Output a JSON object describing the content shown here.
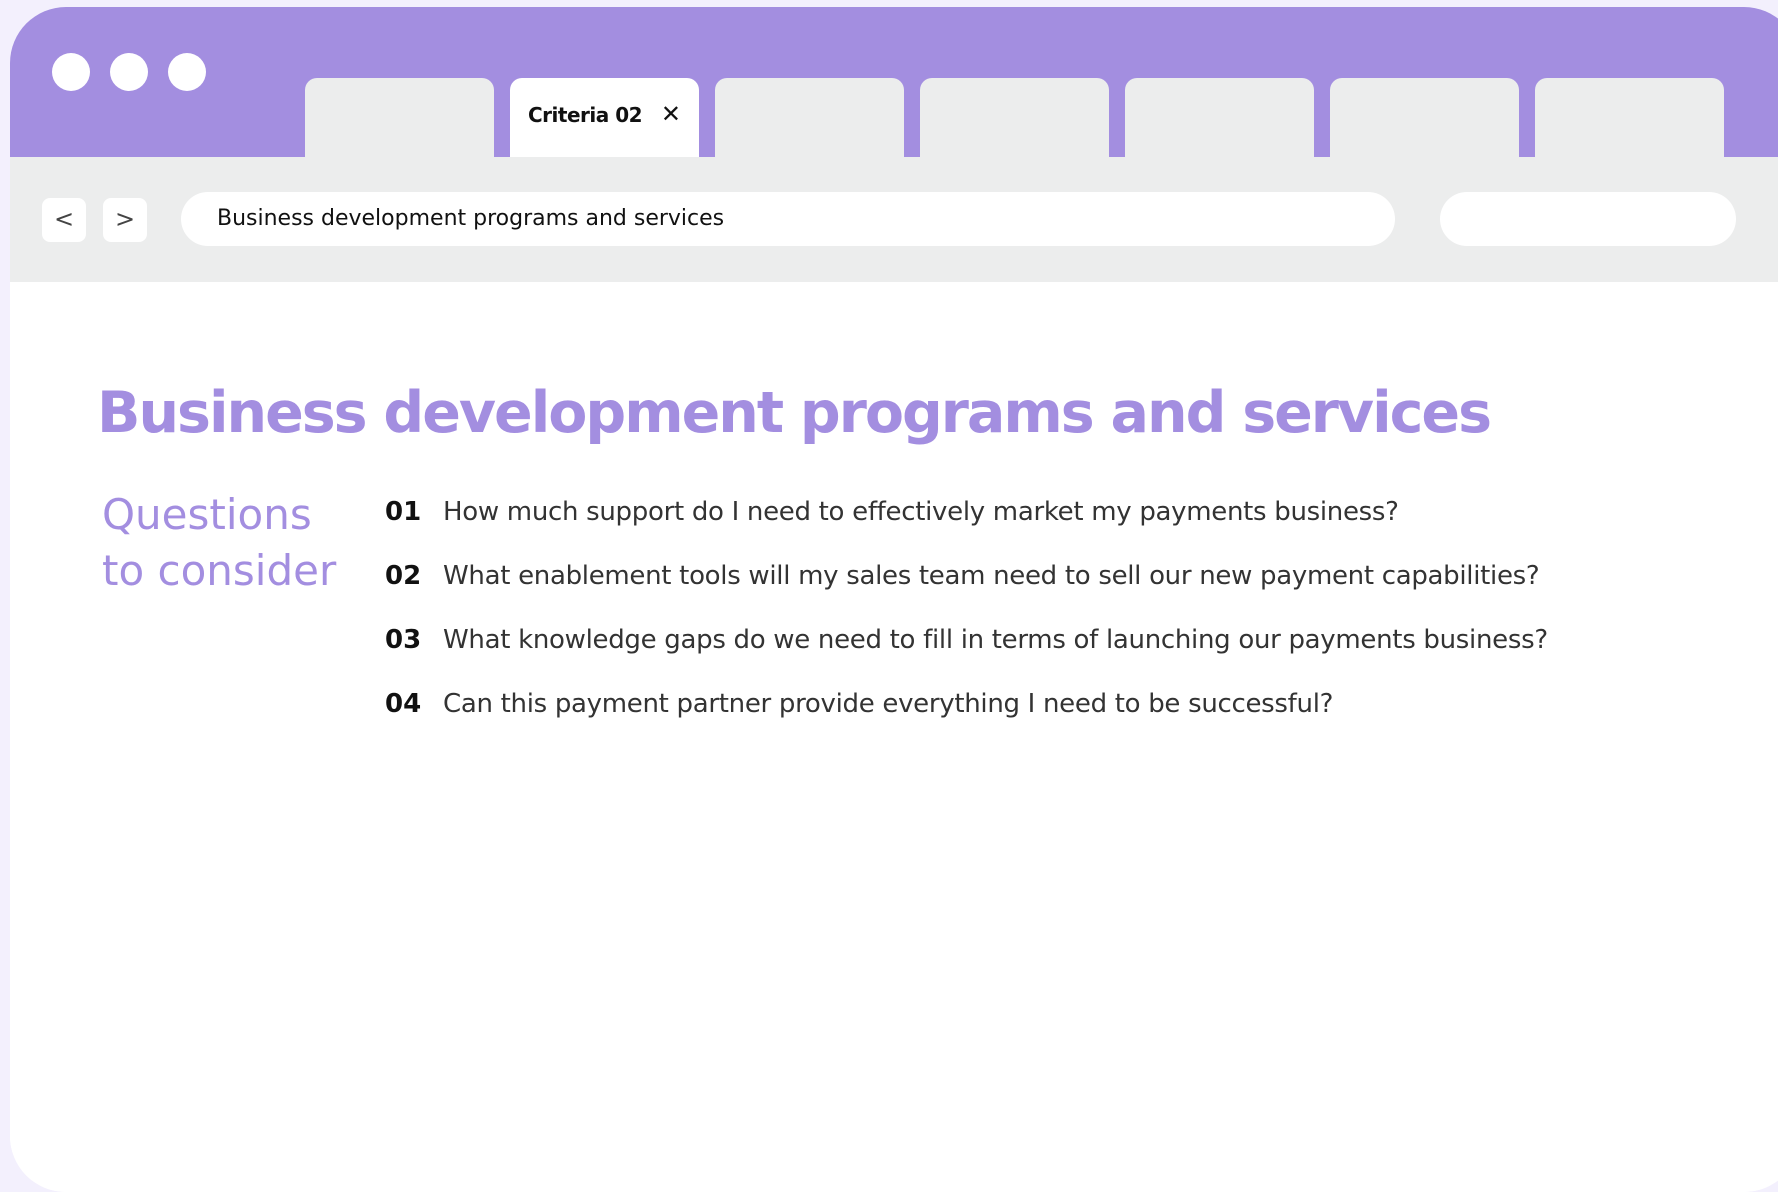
{
  "browser": {
    "tabs": [
      {
        "label": "",
        "active": false
      },
      {
        "label": "Criteria 02",
        "active": true,
        "close_icon": "close-icon"
      },
      {
        "label": "",
        "active": false
      },
      {
        "label": "",
        "active": false
      },
      {
        "label": "",
        "active": false
      },
      {
        "label": "",
        "active": false
      },
      {
        "label": "",
        "active": false
      }
    ],
    "back_label": "<",
    "forward_label": ">",
    "address": "Business development programs and services",
    "search_value": ""
  },
  "page": {
    "title": "Business development programs and services",
    "side_heading": "Questions to consider",
    "questions": [
      {
        "num": "01",
        "text": "How much support do I need to effectively market my payments business?"
      },
      {
        "num": "02",
        "text": "What enablement tools will my sales team need to sell our new payment capabilities?"
      },
      {
        "num": "03",
        "text": "What knowledge gaps do we need to fill in terms of launching our payments business?"
      },
      {
        "num": "04",
        "text": "Can this payment partner provide everything I need to be successful?"
      }
    ]
  },
  "colors": {
    "accent": "#a38ee0",
    "chrome": "#eceded",
    "background": "#f3f0fd"
  }
}
